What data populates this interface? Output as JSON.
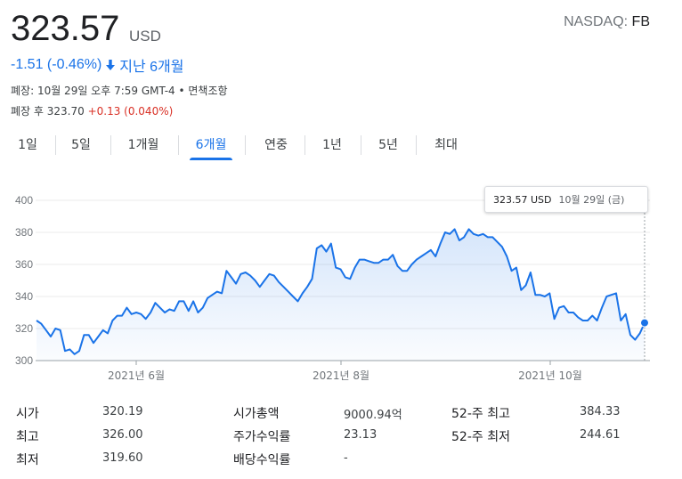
{
  "quote": {
    "price": "323.57",
    "currency": "USD",
    "exchange": "NASDAQ:",
    "symbol": "FB",
    "change": "-1.51 (-0.46%)",
    "period_label": "지난 6개월",
    "meta_line1": "폐장: 10월 29일 오후 7:59 GMT-4 • 면책조항",
    "meta_line2_prefix": "폐장 후 323.70",
    "meta_line2_change": "+0.13 (0.040%)",
    "down_color": "#1a73e8",
    "up_color": "#d93025"
  },
  "tabs": [
    {
      "label": "1일",
      "active": false
    },
    {
      "label": "5일",
      "active": false
    },
    {
      "label": "1개월",
      "active": false
    },
    {
      "label": "6개월",
      "active": true
    },
    {
      "label": "연중",
      "active": false
    },
    {
      "label": "1년",
      "active": false
    },
    {
      "label": "5년",
      "active": false
    },
    {
      "label": "최대",
      "active": false
    }
  ],
  "tooltip": {
    "price": "323.57 USD",
    "date": "10월 29일 (금)"
  },
  "chart_data": {
    "type": "area",
    "ylim": [
      300,
      400
    ],
    "yticks": [
      300,
      320,
      340,
      360,
      380,
      400
    ],
    "xticks": [
      "2021년 6월",
      "2021년 8월",
      "2021년 10월"
    ],
    "line_color": "#1a73e8",
    "grid": true,
    "values": [
      325,
      323,
      319,
      315,
      320,
      319,
      306,
      307,
      304,
      306,
      316,
      316,
      311,
      315,
      319,
      317,
      325,
      328,
      328,
      333,
      329,
      330,
      329,
      326,
      330,
      336,
      333,
      330,
      332,
      331,
      337,
      337,
      331,
      337,
      330,
      333,
      339,
      341,
      343,
      342,
      356,
      352,
      348,
      354,
      355,
      353,
      350,
      346,
      350,
      354,
      353,
      349,
      346,
      343,
      340,
      337,
      342,
      346,
      351,
      370,
      372,
      368,
      373,
      358,
      357,
      352,
      351,
      358,
      363,
      363,
      362,
      361,
      361,
      363,
      363,
      366,
      359,
      356,
      356,
      360,
      363,
      365,
      367,
      369,
      365,
      373,
      380,
      379,
      382,
      375,
      377,
      382,
      379,
      378,
      379,
      377,
      377,
      374,
      371,
      365,
      356,
      358,
      344,
      347,
      355,
      341,
      341,
      340,
      342,
      326,
      333,
      334,
      330,
      330,
      327,
      325,
      325,
      328,
      325,
      333,
      340,
      341,
      342,
      325,
      329,
      316,
      313,
      317,
      323.57
    ]
  },
  "stats": {
    "col1": [
      {
        "label": "시가",
        "value": "320.19"
      },
      {
        "label": "최고",
        "value": "326.00"
      },
      {
        "label": "최저",
        "value": "319.60"
      }
    ],
    "col2": [
      {
        "label": "시가총액",
        "value": "9000.94억"
      },
      {
        "label": "주가수익률",
        "value": "23.13"
      },
      {
        "label": "배당수익률",
        "value": "-"
      }
    ],
    "col3": [
      {
        "label": "52-주 최고",
        "value": "384.33"
      },
      {
        "label": "52-주 최저",
        "value": "244.61"
      }
    ]
  }
}
